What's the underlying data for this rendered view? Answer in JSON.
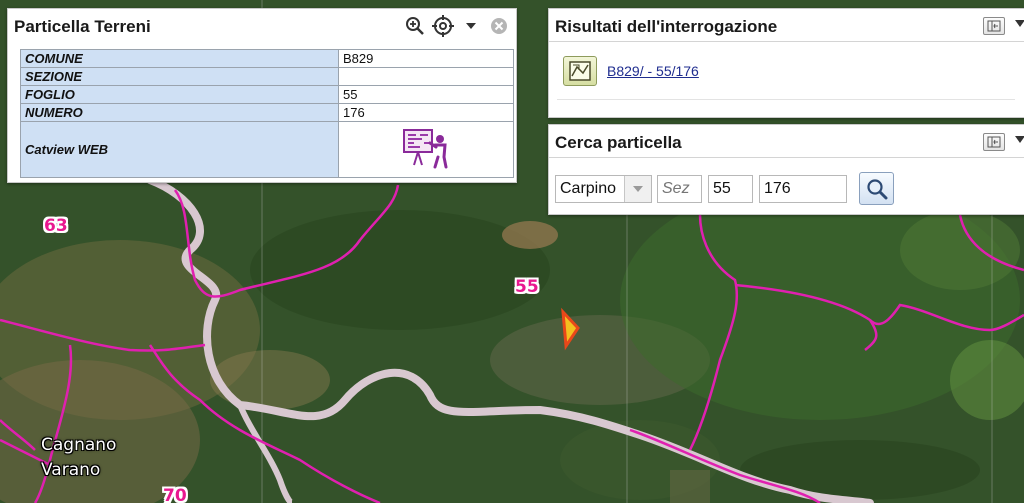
{
  "terreni": {
    "title": "Particella Terreni",
    "icons": [
      "zoom-in-icon",
      "crosshair-icon",
      "dropdown-arrow-icon",
      "close-icon"
    ],
    "rows": [
      {
        "key": "COMUNE",
        "value": "B829"
      },
      {
        "key": "SEZIONE",
        "value": ""
      },
      {
        "key": "FOGLIO",
        "value": "55"
      },
      {
        "key": "NUMERO",
        "value": "176"
      },
      {
        "key": "Catview WEB",
        "value": ""
      }
    ],
    "catview_icon": "presentation-board-icon"
  },
  "risultati": {
    "title": "Risultati dell'interrogazione",
    "result_link": "B829/ - 55/176",
    "result_icon": "map-parcel-icon"
  },
  "cerca": {
    "title": "Cerca particella",
    "comune_value": "Carpino",
    "sezione_placeholder": "Sez",
    "foglio_value": "55",
    "numero_value": "176",
    "search_icon": "magnifier-icon"
  },
  "map": {
    "labels": {
      "sheet_63": "63",
      "sheet_55": "55",
      "sheet_70": "70",
      "town_line1": "Cagnano",
      "town_line2": "Varano"
    },
    "colors": {
      "boundary": "#e020b0",
      "road": "#d8c8d0",
      "marker": "#e8481a"
    }
  }
}
